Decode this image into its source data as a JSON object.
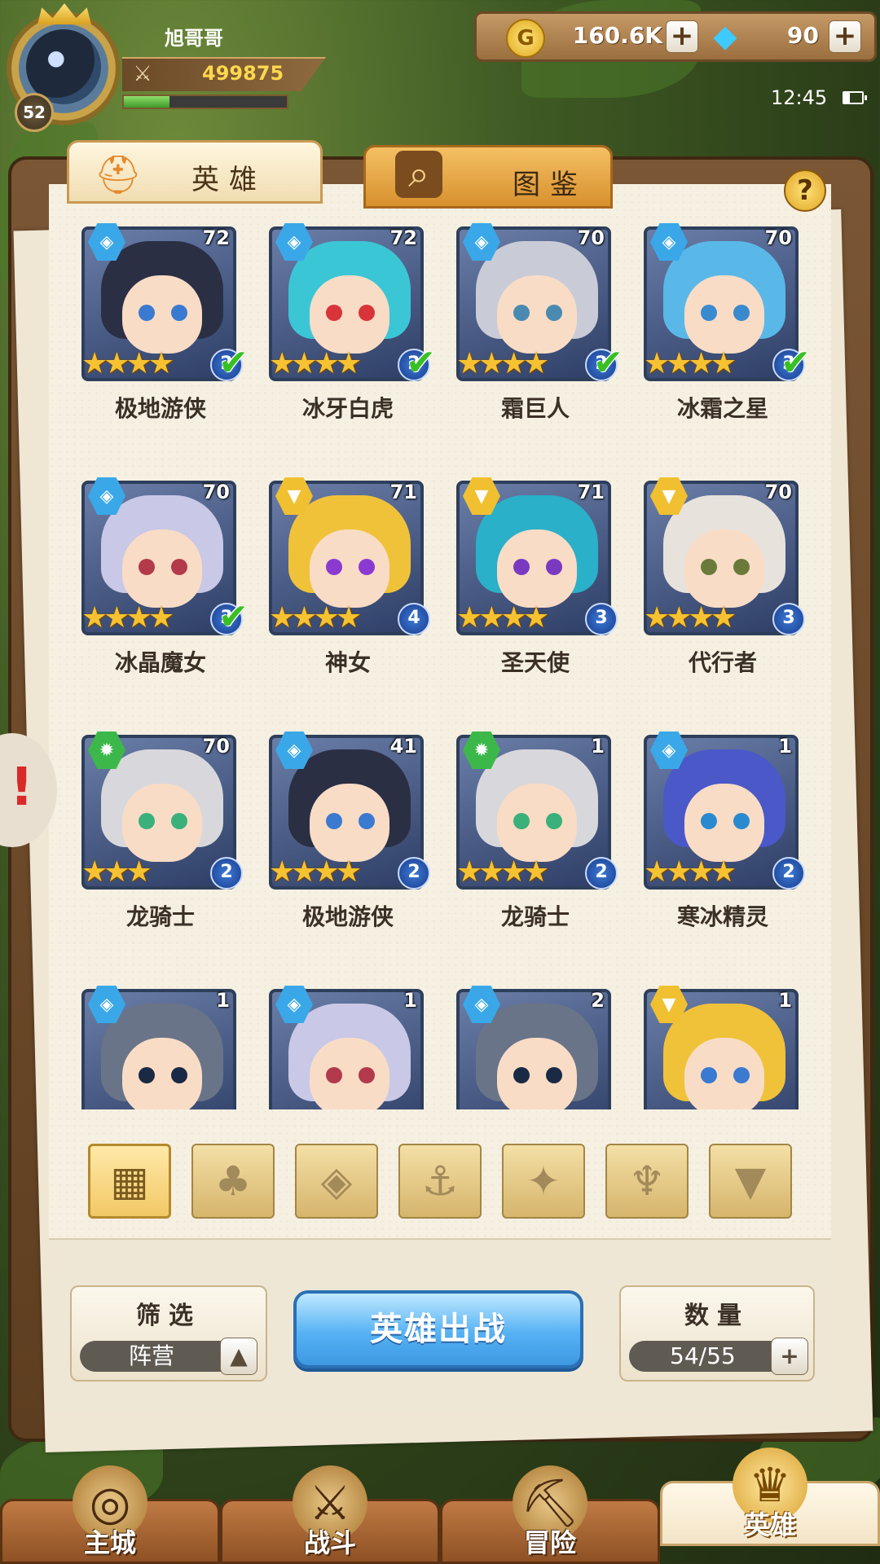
{
  "player": {
    "name": "旭哥哥",
    "level": "52",
    "power": "499875",
    "xp_progress": 0.28
  },
  "currency": {
    "gold": "160.6K",
    "gems": "90",
    "gold_icon_glyph": "G"
  },
  "status": {
    "time": "12:45",
    "battery_level": 0.3
  },
  "tabs": [
    {
      "label": "英雄",
      "icon": "helmet-icon",
      "active": true
    },
    {
      "label": "图鉴",
      "icon": "magnifier-icon",
      "active": false
    }
  ],
  "help": {
    "label": "?"
  },
  "heroes": [
    {
      "name": "极地游侠",
      "level": "72",
      "faction": "ice",
      "stars": 4,
      "rank": "2",
      "ready": true,
      "hair": "#2a2f44",
      "eyes": "#3a7ad0"
    },
    {
      "name": "冰牙白虎",
      "level": "72",
      "faction": "ice",
      "stars": 4,
      "rank": "2",
      "ready": true,
      "hair": "#3bc6d6",
      "eyes": "#d8343a"
    },
    {
      "name": "霜巨人",
      "level": "70",
      "faction": "ice",
      "stars": 4,
      "rank": "2",
      "ready": true,
      "hair": "#c9ccd6",
      "eyes": "#4a8ab0"
    },
    {
      "name": "冰霜之星",
      "level": "70",
      "faction": "ice",
      "stars": 4,
      "rank": "3",
      "ready": true,
      "hair": "#5ab8e8",
      "eyes": "#3a8ad0"
    },
    {
      "name": "冰晶魔女",
      "level": "70",
      "faction": "ice",
      "stars": 4,
      "rank": "3",
      "ready": true,
      "hair": "#c9c8e6",
      "eyes": "#b23a4a"
    },
    {
      "name": "神女",
      "level": "71",
      "faction": "holy",
      "stars": 4,
      "rank": "4",
      "ready": false,
      "hair": "#f0c23a",
      "eyes": "#8a3ad0"
    },
    {
      "name": "圣天使",
      "level": "71",
      "faction": "holy",
      "stars": 4,
      "rank": "3",
      "ready": false,
      "hair": "#2ab0c8",
      "eyes": "#7a3ac0"
    },
    {
      "name": "代行者",
      "level": "70",
      "faction": "holy",
      "stars": 4,
      "rank": "3",
      "ready": false,
      "hair": "#e8e2dc",
      "eyes": "#6a7a3a"
    },
    {
      "name": "龙骑士",
      "level": "70",
      "faction": "beast",
      "stars": 3,
      "rank": "2",
      "ready": false,
      "hair": "#d8d8dc",
      "eyes": "#3ab07a"
    },
    {
      "name": "极地游侠",
      "level": "41",
      "faction": "ice",
      "stars": 4,
      "rank": "2",
      "ready": false,
      "hair": "#2a2f44",
      "eyes": "#3a7ad0"
    },
    {
      "name": "龙骑士",
      "level": "1",
      "faction": "beast",
      "stars": 4,
      "rank": "2",
      "ready": false,
      "hair": "#d8d8dc",
      "eyes": "#3ab07a"
    },
    {
      "name": "寒冰精灵",
      "level": "1",
      "faction": "ice",
      "stars": 4,
      "rank": "2",
      "ready": false,
      "hair": "#4a58c8",
      "eyes": "#2a8ad0"
    },
    {
      "name": "",
      "level": "1",
      "faction": "ice",
      "stars": 0,
      "rank": "",
      "ready": false,
      "hair": "#6a7488",
      "eyes": "#1a2a44"
    },
    {
      "name": "",
      "level": "1",
      "faction": "ice",
      "stars": 0,
      "rank": "",
      "ready": false,
      "hair": "#c9c8e6",
      "eyes": "#b23a4a"
    },
    {
      "name": "",
      "level": "2",
      "faction": "ice",
      "stars": 0,
      "rank": "",
      "ready": false,
      "hair": "#6a7488",
      "eyes": "#1a2a44"
    },
    {
      "name": "",
      "level": "1",
      "faction": "holy",
      "stars": 0,
      "rank": "",
      "ready": false,
      "hair": "#f0c23a",
      "eyes": "#3a7ad0"
    }
  ],
  "faction_colors": {
    "ice": "#3aa8e8",
    "holy": "#f0c030",
    "beast": "#3cb84a"
  },
  "filters": [
    {
      "icon": "grid-all-icon",
      "glyph": "▦",
      "active": true
    },
    {
      "icon": "forest-faction-icon",
      "glyph": "♣",
      "active": false
    },
    {
      "icon": "ice-faction-icon",
      "glyph": "◈",
      "active": false
    },
    {
      "icon": "anchor-faction-icon",
      "glyph": "⚓",
      "active": false
    },
    {
      "icon": "beast-faction-icon",
      "glyph": "✦",
      "active": false
    },
    {
      "icon": "demon-faction-icon",
      "glyph": "♆",
      "active": false
    },
    {
      "icon": "holy-faction-icon",
      "glyph": "▼",
      "active": false
    }
  ],
  "controls": {
    "filter_title": "筛选",
    "filter_value": "阵营",
    "deploy_label": "英雄出战",
    "count_title": "数量",
    "count_value": "54/55"
  },
  "nav": [
    {
      "label": "主城",
      "icon": "city-icon",
      "glyph": "◎",
      "active": false
    },
    {
      "label": "战斗",
      "icon": "crossed-swords-icon",
      "glyph": "⚔",
      "active": false
    },
    {
      "label": "冒险",
      "icon": "map-scroll-icon",
      "glyph": "⛏",
      "active": false
    },
    {
      "label": "英雄",
      "icon": "hero-helmet-icon",
      "glyph": "♛",
      "active": true
    }
  ]
}
